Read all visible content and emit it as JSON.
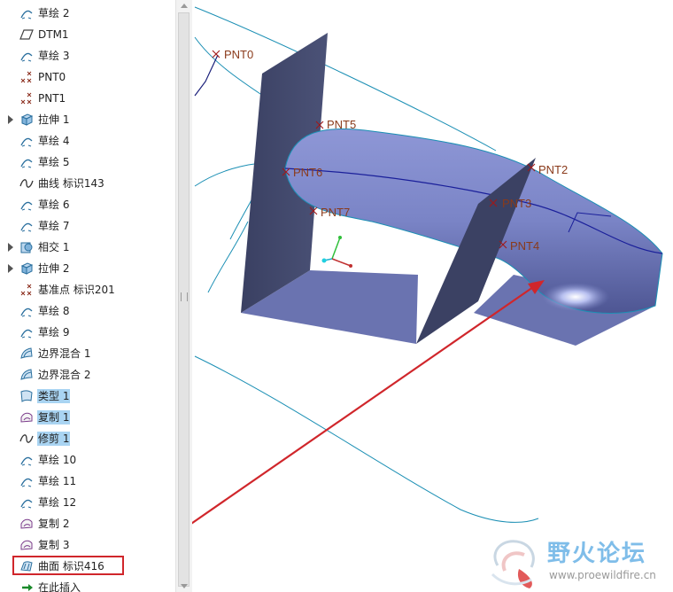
{
  "model_tree": {
    "items": [
      {
        "label": "草绘 2",
        "icon": "sketch-icon",
        "expand": false,
        "hl": false
      },
      {
        "label": "DTM1",
        "icon": "datum-plane-icon",
        "expand": false,
        "hl": false
      },
      {
        "label": "草绘 3",
        "icon": "sketch-icon",
        "expand": false,
        "hl": false
      },
      {
        "label": "PNT0",
        "icon": "datum-point-icon",
        "expand": false,
        "hl": false
      },
      {
        "label": "PNT1",
        "icon": "datum-point-icon",
        "expand": false,
        "hl": false
      },
      {
        "label": "拉伸 1",
        "icon": "extrude-icon",
        "expand": true,
        "hl": false
      },
      {
        "label": "草绘 4",
        "icon": "sketch-icon",
        "expand": false,
        "hl": false
      },
      {
        "label": "草绘 5",
        "icon": "sketch-icon",
        "expand": false,
        "hl": false
      },
      {
        "label": "曲线 标识143",
        "icon": "curve-icon",
        "expand": false,
        "hl": false
      },
      {
        "label": "草绘 6",
        "icon": "sketch-icon",
        "expand": false,
        "hl": false
      },
      {
        "label": "草绘 7",
        "icon": "sketch-icon",
        "expand": false,
        "hl": false
      },
      {
        "label": "相交 1",
        "icon": "intersect-icon",
        "expand": true,
        "hl": false
      },
      {
        "label": "拉伸 2",
        "icon": "extrude-icon",
        "expand": true,
        "hl": false
      },
      {
        "label": "基准点 标识201",
        "icon": "datum-point-icon",
        "expand": false,
        "hl": false
      },
      {
        "label": "草绘 8",
        "icon": "sketch-icon",
        "expand": false,
        "hl": false
      },
      {
        "label": "草绘 9",
        "icon": "sketch-icon",
        "expand": false,
        "hl": false
      },
      {
        "label": "边界混合 1",
        "icon": "boundary-blend-icon",
        "expand": false,
        "hl": false
      },
      {
        "label": "边界混合 2",
        "icon": "boundary-blend-icon",
        "expand": false,
        "hl": false
      },
      {
        "label": "类型 1",
        "icon": "style-surface-icon",
        "expand": false,
        "hl": true
      },
      {
        "label": "复制 1",
        "icon": "copy-surface-icon",
        "expand": false,
        "hl": true
      },
      {
        "label": "修剪 1",
        "icon": "curve-icon",
        "expand": false,
        "hl": true
      },
      {
        "label": "草绘 10",
        "icon": "sketch-icon",
        "expand": false,
        "hl": false
      },
      {
        "label": "草绘 11",
        "icon": "sketch-icon",
        "expand": false,
        "hl": false
      },
      {
        "label": "草绘 12",
        "icon": "sketch-icon",
        "expand": false,
        "hl": false
      },
      {
        "label": "复制 2",
        "icon": "copy-surface-icon",
        "expand": false,
        "hl": false
      },
      {
        "label": "复制 3",
        "icon": "copy-surface-icon",
        "expand": false,
        "hl": false
      },
      {
        "label": "曲面 标识416",
        "icon": "surface-icon",
        "expand": false,
        "hl": false
      },
      {
        "label": "在此插入",
        "icon": "insert-here-arrow-icon",
        "expand": false,
        "hl": false
      }
    ]
  },
  "viewport": {
    "points": [
      "PNT0",
      "PNT5",
      "PNT6",
      "PNT7",
      "PNT2",
      "PNT3",
      "PNT4"
    ]
  },
  "watermark": {
    "title": "野火论坛",
    "url": "www.proewildfire.cn"
  },
  "colors": {
    "selection_highlight": "#a9d4f2",
    "surface_dark": "#3b4163",
    "surface_light": "#7b85c4",
    "curve_cyan": "#1b8fb4",
    "annotation_red": "#d0262b",
    "point_label": "#8a3a1a"
  }
}
